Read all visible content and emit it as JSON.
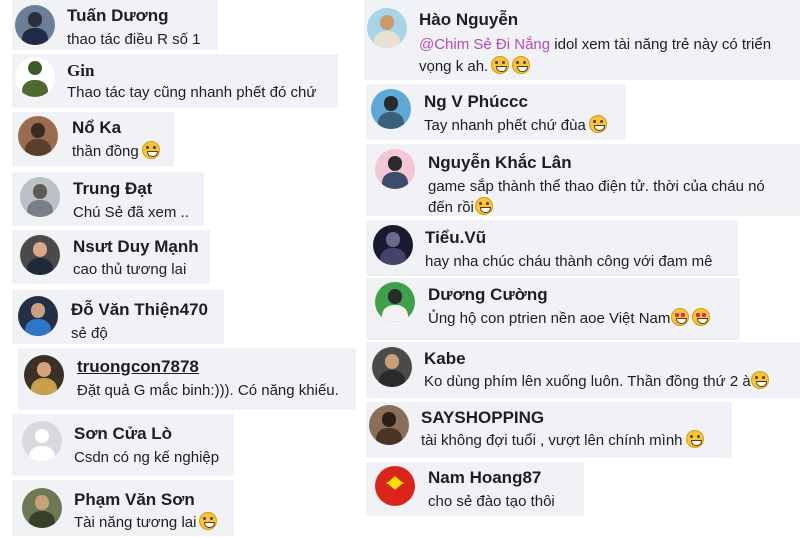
{
  "left_comments": [
    {
      "name": "Tuấn Dương",
      "text": "thao tác điều R số 1",
      "emoji": ""
    },
    {
      "name": "Gin",
      "text": "Thao tác tay cũng nhanh phết đó chứ",
      "emoji": ""
    },
    {
      "name": "Nổ Ka",
      "text": "thần đồng",
      "emoji": "laugh"
    },
    {
      "name": "Trung Đạt",
      "text": "Chú Sẻ đã xem ..",
      "emoji": ""
    },
    {
      "name": "Nsưt Duy Mạnh",
      "text": "cao thủ tương lai",
      "emoji": ""
    },
    {
      "name": "Đỗ Văn Thiện470",
      "text": "sẻ độ",
      "emoji": ""
    },
    {
      "name": "truongcon7878",
      "text": "Đặt quả G mắc binh:))). Có năng khiếu.",
      "emoji": ""
    },
    {
      "name": "Sơn Cửa Lò",
      "text": "Csdn có ng kế nghiệp",
      "emoji": ""
    },
    {
      "name": "Phạm Văn Sơn",
      "text": "Tài năng tương lai",
      "emoji": "laugh"
    }
  ],
  "right_comments": [
    {
      "name": "Hào Nguyễn",
      "mention": "@Chim Sẻ Đi Nắng",
      "text_after_mention": " idol xem tài năng trẻ này có triển",
      "text_line2": "vọng k ah.",
      "emoji": "grin2"
    },
    {
      "name": "Ng V Phúccc",
      "text": "Tay nhanh phết chứ đùa",
      "emoji": "grin"
    },
    {
      "name": "Nguyễn Khắc Lân",
      "text": "game sắp thành thể thao điện tử. thời của cháu nó",
      "text_line2": "đến rồi",
      "emoji": "smirk"
    },
    {
      "name": "Tiểu.Vũ",
      "text": "hay nha chúc cháu thành công với đam mê",
      "emoji": ""
    },
    {
      "name": "Dương Cường",
      "text": "Ủng hộ con ptrien nền aoe Việt Nam",
      "emoji": "heart2"
    },
    {
      "name": "Kabe",
      "text": "Ko dùng phím lên xuống luôn. Thần đồng thứ 2 à",
      "emoji": "laugh"
    },
    {
      "name": "SAYSHOPPING",
      "text": "tài không đợi tuổi , vượt lên chính mình",
      "emoji": "laugh"
    },
    {
      "name": "Nam Hoang87",
      "text": "cho sẻ đào tạo thôi",
      "emoji": ""
    }
  ],
  "colors": {
    "bubble": "#f0f2f5",
    "mention": "#b44bb7",
    "text": "#1c1e21"
  }
}
